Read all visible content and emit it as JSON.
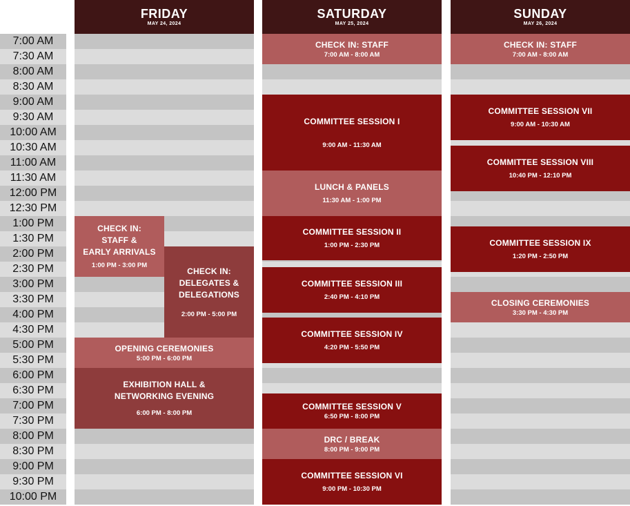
{
  "times": [
    "7:00 AM",
    "7:30 AM",
    "8:00 AM",
    "8:30 AM",
    "9:00 AM",
    "9:30 AM",
    "10:00 AM",
    "10:30 AM",
    "11:00 AM",
    "11:30 AM",
    "12:00 PM",
    "12:30 PM",
    "1:00 PM",
    "1:30 PM",
    "2:00 PM",
    "2:30 PM",
    "3:00 PM",
    "3:30 PM",
    "4:00 PM",
    "4:30 PM",
    "5:00 PM",
    "5:30 PM",
    "6:00 PM",
    "6:30 PM",
    "7:00 PM",
    "7:30 PM",
    "8:00 PM",
    "8:30 PM",
    "9:00 PM",
    "9:30 PM",
    "10:00 PM"
  ],
  "colors": {
    "header": "#3f1515",
    "light_event": "#b05c5c",
    "dark_event": "#871010",
    "medium_event": "#8e3c3c",
    "row_dark": "#c4c4c4",
    "row_light": "#dcdcdc"
  },
  "days": [
    {
      "name": "FRIDAY",
      "date": "MAY 24, 2024",
      "events": [
        {
          "title": "CHECK IN:\nSTAFF &\nEARLY ARRIVALS",
          "time": "1:00 PM - 3:00 PM",
          "style": "light"
        },
        {
          "title": "CHECK IN:\nDELEGATES &\nDELEGATIONS",
          "time": "2:00 PM - 5:00 PM",
          "style": "medium"
        },
        {
          "title": "OPENING CEREMONIES",
          "time": "5:00 PM - 6:00 PM",
          "style": "light"
        },
        {
          "title": "EXHIBITION HALL &\nNETWORKING EVENING",
          "time": "6:00 PM - 8:00 PM",
          "style": "medium"
        }
      ]
    },
    {
      "name": "SATURDAY",
      "date": "MAY 25, 2024",
      "events": [
        {
          "title": "CHECK IN: STAFF",
          "time": "7:00 AM - 8:00 AM",
          "style": "light"
        },
        {
          "title": "COMMITTEE SESSION I",
          "time": "9:00 AM - 11:30 AM",
          "style": "dark"
        },
        {
          "title": "LUNCH & PANELS",
          "time": "11:30 AM - 1:00 PM",
          "style": "light"
        },
        {
          "title": "COMMITTEE SESSION II",
          "time": "1:00 PM - 2:30 PM",
          "style": "dark"
        },
        {
          "title": "COMMITTEE SESSION III",
          "time": "2:40 PM - 4:10 PM",
          "style": "dark"
        },
        {
          "title": "COMMITTEE SESSION IV",
          "time": "4:20 PM - 5:50 PM",
          "style": "dark"
        },
        {
          "title": "COMMITTEE SESSION V",
          "time": "6:50 PM - 8:00 PM",
          "style": "dark"
        },
        {
          "title": "DRC / BREAK",
          "time": "8:00 PM - 9:00 PM",
          "style": "light"
        },
        {
          "title": "COMMITTEE SESSION VI",
          "time": "9:00 PM - 10:30 PM",
          "style": "dark"
        }
      ]
    },
    {
      "name": "SUNDAY",
      "date": "MAY 26, 2024",
      "events": [
        {
          "title": "CHECK IN: STAFF",
          "time": "7:00 AM - 8:00 AM",
          "style": "light"
        },
        {
          "title": "COMMITTEE SESSION VII",
          "time": "9:00 AM - 10:30 AM",
          "style": "dark"
        },
        {
          "title": "COMMITTEE SESSION VIII",
          "time": "10:40 PM - 12:10 PM",
          "style": "dark"
        },
        {
          "title": "COMMITTEE SESSION IX",
          "time": "1:20 PM - 2:50 PM",
          "style": "dark"
        },
        {
          "title": "CLOSING CEREMONIES",
          "time": "3:30 PM - 4:30 PM",
          "style": "light"
        }
      ]
    }
  ]
}
